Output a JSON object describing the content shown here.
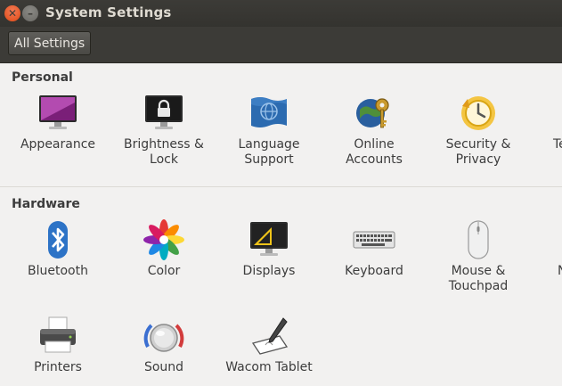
{
  "window": {
    "title": "System Settings"
  },
  "toolbar": {
    "all_settings_label": "All Settings"
  },
  "sections": {
    "personal": {
      "title": "Personal",
      "items": [
        {
          "label": "Appearance"
        },
        {
          "label": "Brightness &\nLock"
        },
        {
          "label": "Language\nSupport"
        },
        {
          "label": "Online\nAccounts"
        },
        {
          "label": "Security &\nPrivacy"
        },
        {
          "label": "Te"
        }
      ]
    },
    "hardware": {
      "title": "Hardware",
      "items": [
        {
          "label": "Bluetooth"
        },
        {
          "label": "Color"
        },
        {
          "label": "Displays"
        },
        {
          "label": "Keyboard"
        },
        {
          "label": "Mouse &\nTouchpad"
        },
        {
          "label": "N"
        },
        {
          "label": "Printers"
        },
        {
          "label": "Sound"
        },
        {
          "label": "Wacom Tablet"
        }
      ]
    }
  }
}
